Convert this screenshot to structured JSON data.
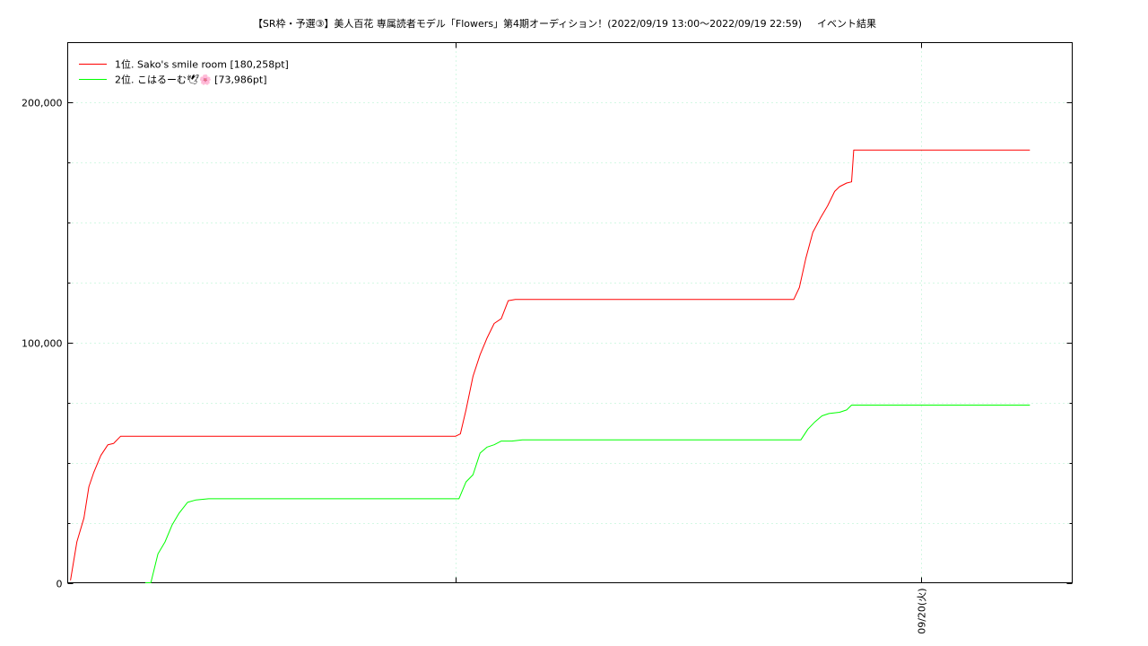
{
  "title": "【SR枠・予選③】美人百花 専属読者モデル「Flowers」第4期オーディション！(2022/09/19 13:00〜2022/09/19 22:59)",
  "subtitle": "イベント結果",
  "chart_data": {
    "type": "line",
    "title": "【SR枠・予選③】美人百花 専属読者モデル「Flowers」第4期オーディション！(2022/09/19 13:00〜2022/09/19 22:59)",
    "subtitle": "イベント結果",
    "xlabel": "",
    "ylabel": "",
    "xlim": [
      0,
      14.25
    ],
    "ylim": [
      0,
      225000
    ],
    "yticks": [
      {
        "value": 0,
        "label": "0"
      },
      {
        "value": 100000,
        "label": "100,000"
      },
      {
        "value": 200000,
        "label": "200,000"
      }
    ],
    "yminor": [
      25000,
      50000,
      75000,
      125000,
      150000,
      175000
    ],
    "xticks": [
      {
        "value": 5.5,
        "label": ""
      },
      {
        "value": 12.1,
        "label": "09/20(火)"
      }
    ],
    "grid": true,
    "legend_position": "top-left",
    "series": [
      {
        "name": "1位. Sako's smile room [180,258pt]",
        "color": "#ff0000",
        "points": [
          [
            0.04,
            1000
          ],
          [
            0.13,
            17000
          ],
          [
            0.23,
            27000
          ],
          [
            0.3,
            40000
          ],
          [
            0.37,
            46000
          ],
          [
            0.47,
            53000
          ],
          [
            0.57,
            57500
          ],
          [
            0.65,
            58000
          ],
          [
            0.75,
            61000
          ],
          [
            1.5,
            61000
          ],
          [
            3.0,
            61000
          ],
          [
            4.5,
            61000
          ],
          [
            5.5,
            61000
          ],
          [
            5.57,
            62000
          ],
          [
            5.65,
            72000
          ],
          [
            5.75,
            86000
          ],
          [
            5.85,
            95000
          ],
          [
            5.95,
            102000
          ],
          [
            6.05,
            108000
          ],
          [
            6.15,
            110000
          ],
          [
            6.25,
            117500
          ],
          [
            6.35,
            118000
          ],
          [
            7.5,
            118000
          ],
          [
            9.0,
            118000
          ],
          [
            10.3,
            118000
          ],
          [
            10.38,
            123000
          ],
          [
            10.47,
            135000
          ],
          [
            10.57,
            146000
          ],
          [
            10.68,
            152000
          ],
          [
            10.78,
            157000
          ],
          [
            10.88,
            163000
          ],
          [
            10.95,
            165000
          ],
          [
            11.05,
            166500
          ],
          [
            11.12,
            167000
          ],
          [
            11.15,
            180258
          ],
          [
            12.5,
            180258
          ],
          [
            13.65,
            180258
          ]
        ]
      },
      {
        "name": "2位. こはるーむ🕊🌸 [73,986pt]",
        "color": "#00ff00",
        "points": [
          [
            1.1,
            0
          ],
          [
            1.18,
            0
          ],
          [
            1.28,
            12000
          ],
          [
            1.38,
            17000
          ],
          [
            1.48,
            24000
          ],
          [
            1.58,
            29000
          ],
          [
            1.7,
            33500
          ],
          [
            1.82,
            34500
          ],
          [
            2.0,
            35000
          ],
          [
            3.5,
            35000
          ],
          [
            5.0,
            35000
          ],
          [
            5.55,
            35000
          ],
          [
            5.65,
            42000
          ],
          [
            5.75,
            45000
          ],
          [
            5.85,
            54000
          ],
          [
            5.95,
            56500
          ],
          [
            6.05,
            57500
          ],
          [
            6.15,
            59000
          ],
          [
            6.3,
            59000
          ],
          [
            6.45,
            59500
          ],
          [
            8.0,
            59500
          ],
          [
            10.4,
            59500
          ],
          [
            10.5,
            64000
          ],
          [
            10.6,
            67000
          ],
          [
            10.7,
            69500
          ],
          [
            10.8,
            70500
          ],
          [
            10.95,
            71000
          ],
          [
            11.05,
            72000
          ],
          [
            11.12,
            73986
          ],
          [
            12.5,
            73986
          ],
          [
            13.65,
            73986
          ]
        ]
      }
    ]
  }
}
